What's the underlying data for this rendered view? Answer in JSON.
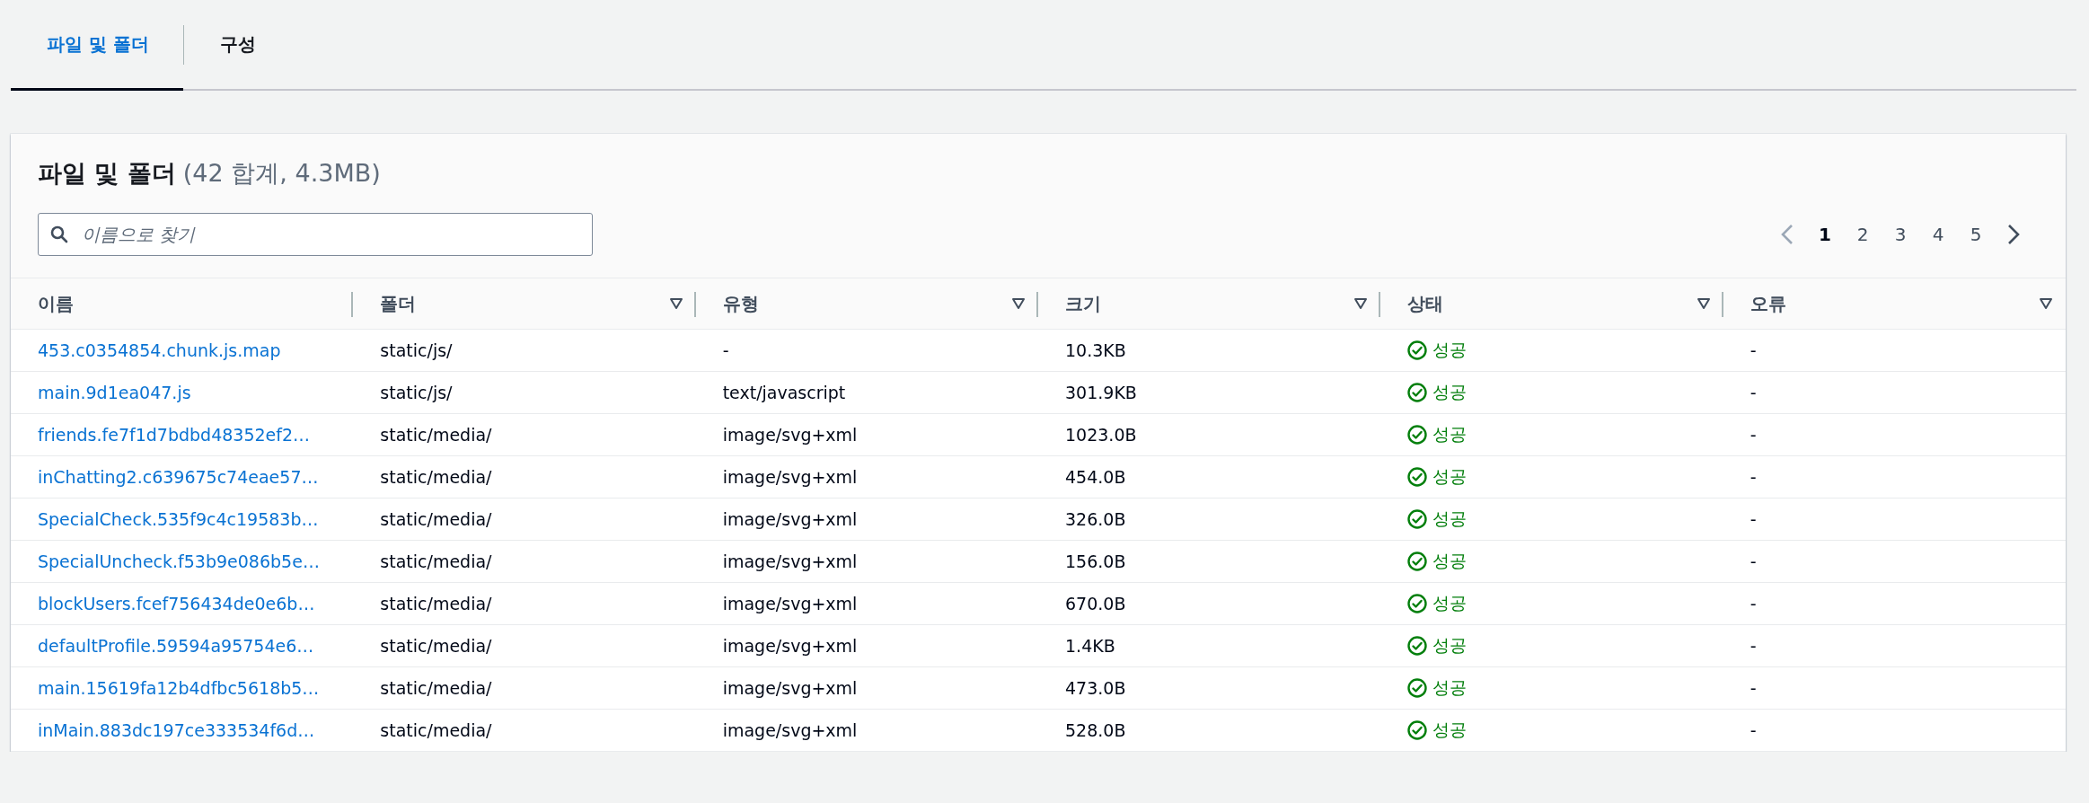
{
  "tabs": [
    {
      "label": "파일 및 폴더",
      "selected": true
    },
    {
      "label": "구성",
      "selected": false
    }
  ],
  "panel": {
    "title": "파일 및 폴더",
    "count": "(42 합계, 4.3MB)"
  },
  "search": {
    "placeholder": "이름으로 찾기"
  },
  "pagination": {
    "prev_disabled": true,
    "next_disabled": false,
    "pages": [
      {
        "label": "1",
        "selected": true
      },
      {
        "label": "2",
        "selected": false
      },
      {
        "label": "3",
        "selected": false
      },
      {
        "label": "4",
        "selected": false
      },
      {
        "label": "5",
        "selected": false
      }
    ]
  },
  "table": {
    "columns": [
      {
        "label": "이름",
        "filter": false
      },
      {
        "label": "폴더",
        "filter": true
      },
      {
        "label": "유형",
        "filter": true
      },
      {
        "label": "크기",
        "filter": true
      },
      {
        "label": "상태",
        "filter": true
      },
      {
        "label": "오류",
        "filter": true
      }
    ],
    "rows": [
      {
        "name": "453.c0354854.chunk.js.map",
        "folder": "static/js/",
        "type": "-",
        "size": "10.3KB",
        "status": {
          "kind": "success",
          "label": "성공"
        },
        "error": "-"
      },
      {
        "name": "main.9d1ea047.js",
        "folder": "static/js/",
        "type": "text/javascript",
        "size": "301.9KB",
        "status": {
          "kind": "success",
          "label": "성공"
        },
        "error": "-"
      },
      {
        "name": "friends.fe7f1d7bdbd48352ef2…",
        "folder": "static/media/",
        "type": "image/svg+xml",
        "size": "1023.0B",
        "status": {
          "kind": "success",
          "label": "성공"
        },
        "error": "-"
      },
      {
        "name": "inChatting2.c639675c74eae57…",
        "folder": "static/media/",
        "type": "image/svg+xml",
        "size": "454.0B",
        "status": {
          "kind": "success",
          "label": "성공"
        },
        "error": "-"
      },
      {
        "name": "SpecialCheck.535f9c4c19583b…",
        "folder": "static/media/",
        "type": "image/svg+xml",
        "size": "326.0B",
        "status": {
          "kind": "success",
          "label": "성공"
        },
        "error": "-"
      },
      {
        "name": "SpecialUncheck.f53b9e086b5e…",
        "folder": "static/media/",
        "type": "image/svg+xml",
        "size": "156.0B",
        "status": {
          "kind": "success",
          "label": "성공"
        },
        "error": "-"
      },
      {
        "name": "blockUsers.fcef756434de0e6b…",
        "folder": "static/media/",
        "type": "image/svg+xml",
        "size": "670.0B",
        "status": {
          "kind": "success",
          "label": "성공"
        },
        "error": "-"
      },
      {
        "name": "defaultProfile.59594a95754e6…",
        "folder": "static/media/",
        "type": "image/svg+xml",
        "size": "1.4KB",
        "status": {
          "kind": "success",
          "label": "성공"
        },
        "error": "-"
      },
      {
        "name": "main.15619fa12b4dfbc5618b5…",
        "folder": "static/media/",
        "type": "image/svg+xml",
        "size": "473.0B",
        "status": {
          "kind": "success",
          "label": "성공"
        },
        "error": "-"
      },
      {
        "name": "inMain.883dc197ce333534f6d…",
        "folder": "static/media/",
        "type": "image/svg+xml",
        "size": "528.0B",
        "status": {
          "kind": "success",
          "label": "성공"
        },
        "error": "-"
      }
    ]
  }
}
